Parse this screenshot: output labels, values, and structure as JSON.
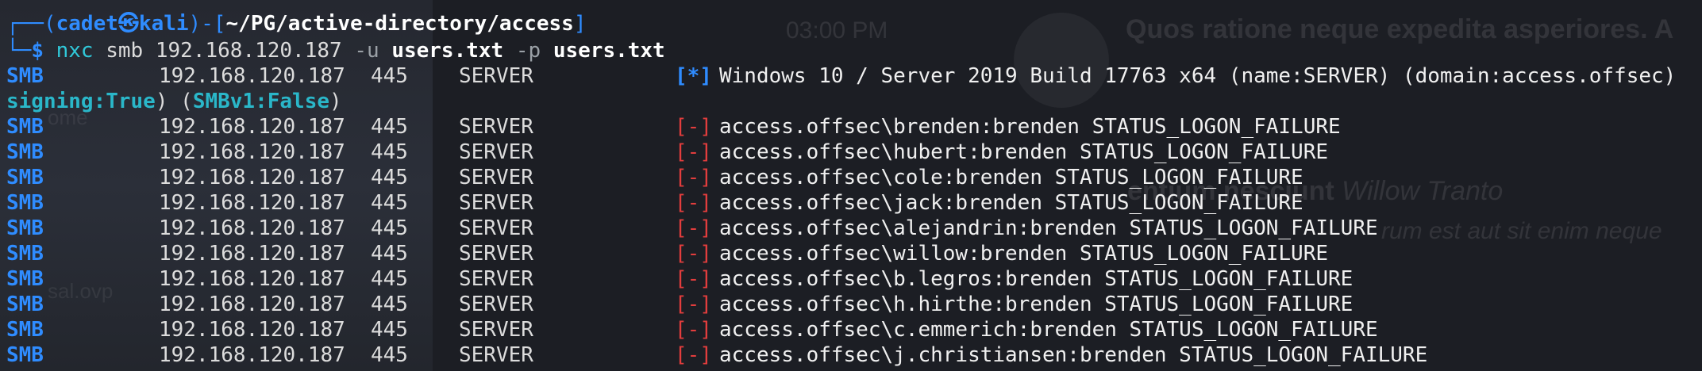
{
  "background": {
    "time": "03:00 PM",
    "post_title": "Quos ratione neque expedita asperiores. A",
    "post_author_line": "entium nesciunt",
    "post_author": "Willow Tranto",
    "post_quote": "rum est aut sit enim neque",
    "left_text_1": "ome",
    "left_text_2": "sal.ovp"
  },
  "prompt": {
    "user": "cadet",
    "host": "kali",
    "path": "~/PG/active-directory/access",
    "command": "nxc",
    "protocol_arg": "smb",
    "target": "192.168.120.187",
    "user_flag": "-u",
    "user_file": "users.txt",
    "pass_flag": "-p",
    "pass_file": "users.txt"
  },
  "info_line": {
    "proto": "SMB",
    "ip": "192.168.120.187",
    "port": "445",
    "host": "SERVER",
    "flag": "[*]",
    "message": "Windows 10 / Server 2019 Build 17763 x64 (name:SERVER) (domain:access.offsec)",
    "wrap_signing_key": "signing:True",
    "wrap_smbv1_key": "SMBv1:False"
  },
  "results": [
    {
      "proto": "SMB",
      "ip": "192.168.120.187",
      "port": "445",
      "host": "SERVER",
      "flag": "[-]",
      "message": "access.offsec\\brenden:brenden STATUS_LOGON_FAILURE"
    },
    {
      "proto": "SMB",
      "ip": "192.168.120.187",
      "port": "445",
      "host": "SERVER",
      "flag": "[-]",
      "message": "access.offsec\\hubert:brenden STATUS_LOGON_FAILURE"
    },
    {
      "proto": "SMB",
      "ip": "192.168.120.187",
      "port": "445",
      "host": "SERVER",
      "flag": "[-]",
      "message": "access.offsec\\cole:brenden STATUS_LOGON_FAILURE"
    },
    {
      "proto": "SMB",
      "ip": "192.168.120.187",
      "port": "445",
      "host": "SERVER",
      "flag": "[-]",
      "message": "access.offsec\\jack:brenden STATUS_LOGON_FAILURE"
    },
    {
      "proto": "SMB",
      "ip": "192.168.120.187",
      "port": "445",
      "host": "SERVER",
      "flag": "[-]",
      "message": "access.offsec\\alejandrin:brenden STATUS_LOGON_FAILURE"
    },
    {
      "proto": "SMB",
      "ip": "192.168.120.187",
      "port": "445",
      "host": "SERVER",
      "flag": "[-]",
      "message": "access.offsec\\willow:brenden STATUS_LOGON_FAILURE"
    },
    {
      "proto": "SMB",
      "ip": "192.168.120.187",
      "port": "445",
      "host": "SERVER",
      "flag": "[-]",
      "message": "access.offsec\\b.legros:brenden STATUS_LOGON_FAILURE"
    },
    {
      "proto": "SMB",
      "ip": "192.168.120.187",
      "port": "445",
      "host": "SERVER",
      "flag": "[-]",
      "message": "access.offsec\\h.hirthe:brenden STATUS_LOGON_FAILURE"
    },
    {
      "proto": "SMB",
      "ip": "192.168.120.187",
      "port": "445",
      "host": "SERVER",
      "flag": "[-]",
      "message": "access.offsec\\c.emmerich:brenden STATUS_LOGON_FAILURE"
    },
    {
      "proto": "SMB",
      "ip": "192.168.120.187",
      "port": "445",
      "host": "SERVER",
      "flag": "[-]",
      "message": "access.offsec\\j.christiansen:brenden STATUS_LOGON_FAILURE"
    }
  ],
  "colors": {
    "prompt_blue": "#2f8cff",
    "info_cyan": "#30c8d9",
    "fail_red": "#e23d3d",
    "background": "#1b1d24"
  }
}
